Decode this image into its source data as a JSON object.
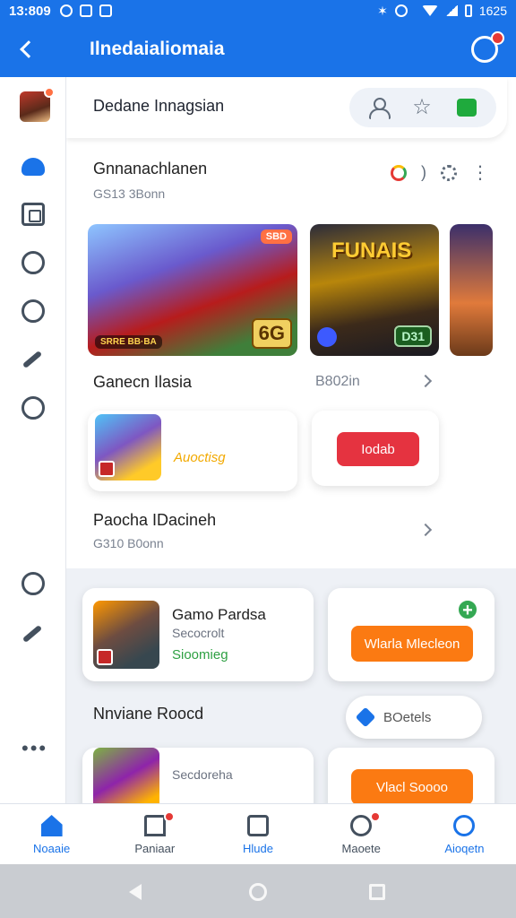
{
  "status_bar": {
    "time": "13:809",
    "right_text": "1625"
  },
  "app_bar": {
    "title": "Ilnedaialiomaia"
  },
  "top_card": {
    "name": "Dedane Innagsian"
  },
  "featured": {
    "title": "Gnnanachlanen",
    "subtitle": "GS13 3Bonn",
    "banner_a": {
      "top_tag": "SBD",
      "level": "6G",
      "bottom_tag": "SRRE BB·BA"
    },
    "banner_b": {
      "logo": "FUNAIS",
      "score": "D31"
    }
  },
  "section2": {
    "title": "Ganecn Ilasia",
    "link": "B802in",
    "card": {
      "label": "Auoctisg"
    },
    "button": "Iodab"
  },
  "section3": {
    "title": "Paocha IDacineh",
    "subtitle": "G310 B0onn"
  },
  "game_card": {
    "title": "Gamo Pardsa",
    "subtitle": "Secocrolt",
    "status": "Sioomieg",
    "button": "Wlarla Mlecleon"
  },
  "section4": {
    "title": "Nnviane Roocd",
    "pill": "BOetels"
  },
  "game_card2": {
    "subtitle": "Secdoreha",
    "button": "Vlacl Soooo"
  },
  "bottom_nav": [
    {
      "label": "Noaaie",
      "color": "#1a73e8"
    },
    {
      "label": "Paniaar",
      "color": "#44505e"
    },
    {
      "label": "Hlude",
      "color": "#1a73e8"
    },
    {
      "label": "Maoete",
      "color": "#44505e"
    },
    {
      "label": "Aioqetn",
      "color": "#1a73e8"
    }
  ],
  "colors": {
    "primary": "#1a73e8",
    "danger": "#e53340",
    "accent": "#fb7a12",
    "success": "#34a853"
  }
}
